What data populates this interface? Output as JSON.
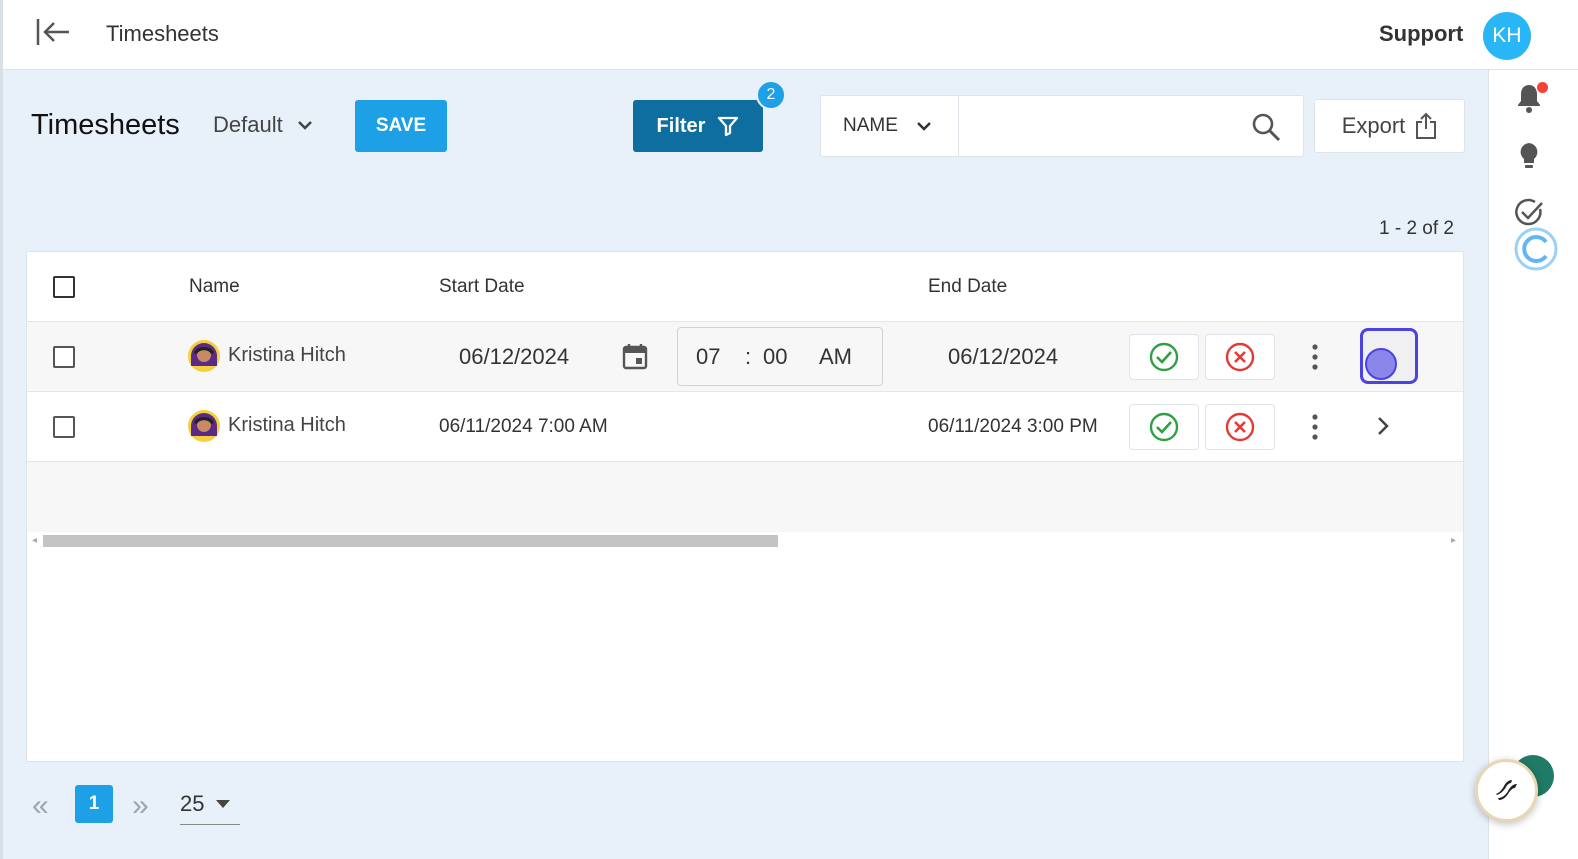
{
  "topbar": {
    "title": "Timesheets",
    "support_label": "Support",
    "user_initials": "KH",
    "avatar_color": "#29b6f6"
  },
  "toolbar": {
    "page_title": "Timesheets",
    "view_selected": "Default",
    "save_label": "SAVE",
    "filter_label": "Filter",
    "filter_count": "2",
    "search_field": "NAME",
    "search_value": "",
    "export_label": "Export"
  },
  "results": {
    "count_text": "1 - 2 of 2"
  },
  "table": {
    "columns": [
      "Name",
      "Start Date",
      "End Date"
    ],
    "rows": [
      {
        "name": "Kristina Hitch",
        "editing": true,
        "start_date": "06/12/2024",
        "start_hour": "07",
        "time_sep": ":",
        "start_minute": "00",
        "start_ampm": "AM",
        "end_date": "06/12/2024"
      },
      {
        "name": "Kristina Hitch",
        "editing": false,
        "start": "06/11/2024 7:00 AM",
        "end": "06/11/2024 3:00 PM"
      }
    ]
  },
  "pagination": {
    "current_page": "1",
    "page_size": "25"
  },
  "colors": {
    "primary": "#1ea0e6",
    "filter_bg": "#0f6ea0",
    "approve": "#2ea043",
    "reject": "#e53935",
    "focus": "#4a43e0"
  },
  "icons": [
    "collapse-sidebar-icon",
    "bell-icon",
    "lightbulb-icon",
    "check-circle-icon",
    "refresh-icon",
    "filter-icon",
    "search-icon",
    "export-icon",
    "calendar-icon",
    "approve-icon",
    "reject-icon",
    "more-vertical-icon",
    "chevron-right-icon",
    "chevron-down-icon"
  ]
}
